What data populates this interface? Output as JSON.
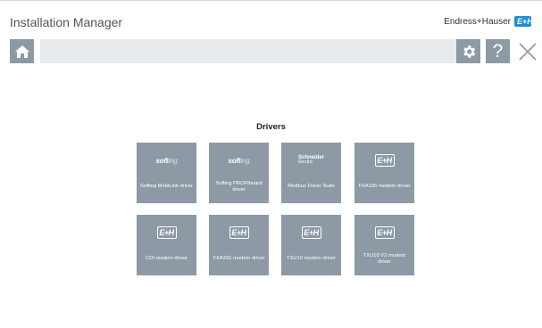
{
  "app": {
    "title": "Installation Manager",
    "brand_name": "Endress+Hauser",
    "brand_logo_text": "E+H",
    "accent_color": "#1c8fd6",
    "tile_color": "#8d9aa6",
    "toolbar_button_color": "#8c9aa5"
  },
  "toolbar": {
    "home_icon": "home-icon",
    "settings_icon": "gear-icon",
    "help_label": "?",
    "close_icon": "close-icon"
  },
  "drivers": {
    "title": "Drivers",
    "items": [
      {
        "label": "Softing MobiLink driver",
        "logo": "softing",
        "logo_text": "soft",
        "logo_light": "ing"
      },
      {
        "label": "Softing PROFIboard driver",
        "logo": "softing",
        "logo_text": "soft",
        "logo_light": "ing"
      },
      {
        "label": "Modbus Driver Suite",
        "logo": "schneider",
        "logo_text": "Schneider",
        "logo_sub": "Electric"
      },
      {
        "label": "FXA195 modem driver",
        "logo": "eh",
        "logo_text": "E+H"
      },
      {
        "label": "CDI modem driver",
        "logo": "eh",
        "logo_text": "E+H"
      },
      {
        "label": "FXA291 modem driver",
        "logo": "eh",
        "logo_text": "E+H"
      },
      {
        "label": "TXU10 modem driver",
        "logo": "eh",
        "logo_text": "E+H"
      },
      {
        "label": "TXU10 V2 modem driver",
        "logo": "eh",
        "logo_text": "E+H"
      }
    ]
  }
}
